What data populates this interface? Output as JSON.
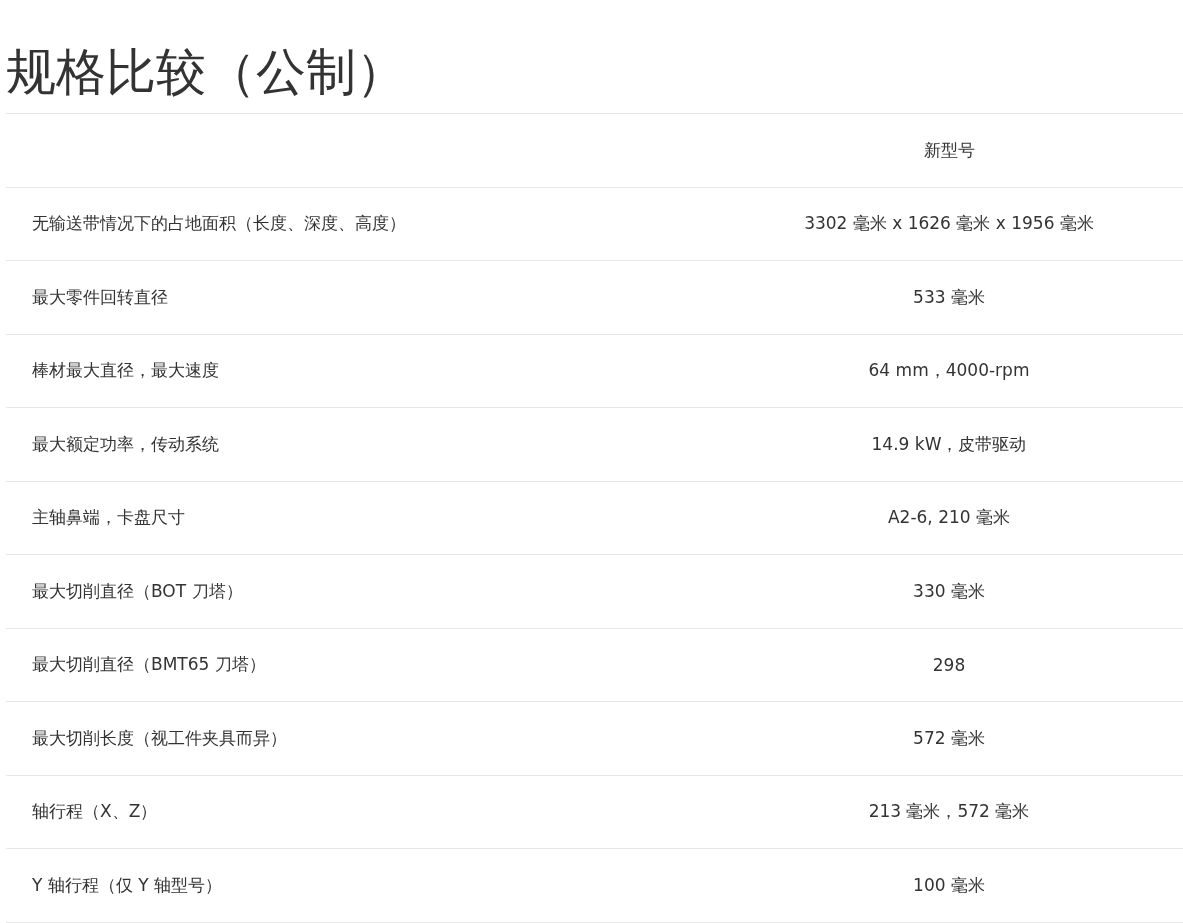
{
  "title": "规格比较（公制）",
  "table": {
    "columns": [
      "",
      "新型号"
    ],
    "rows": [
      {
        "label": "无输送带情况下的占地面积（长度、深度、高度）",
        "value": "3302 毫米 x 1626 毫米 x 1956 毫米"
      },
      {
        "label": "最大零件回转直径",
        "value": "533 毫米"
      },
      {
        "label": "棒材最大直径，最大速度",
        "value": "64 mm，4000-rpm"
      },
      {
        "label": "最大额定功率，传动系统",
        "value": "14.9 kW，皮带驱动"
      },
      {
        "label": "主轴鼻端，卡盘尺寸",
        "value": "A2-6, 210 毫米"
      },
      {
        "label": "最大切削直径（BOT 刀塔）",
        "value": "330 毫米"
      },
      {
        "label": "最大切削直径（BMT65 刀塔）",
        "value": "298"
      },
      {
        "label": "最大切削长度（视工件夹具而异）",
        "value": "572 毫米"
      },
      {
        "label": "轴行程（X、Z）",
        "value": "213 毫米，572 毫米"
      },
      {
        "label": "Y 轴行程（仅 Y 轴型号）",
        "value": "100 毫米"
      }
    ]
  }
}
